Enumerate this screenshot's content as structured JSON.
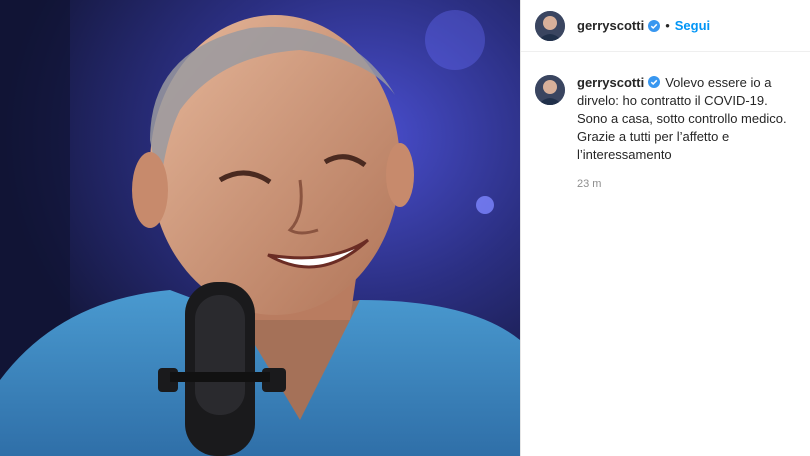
{
  "post": {
    "photo_alt": "Man smiling in front of a microphone"
  },
  "header": {
    "username": "gerryscotti",
    "separator": "•",
    "follow_label": "Segui"
  },
  "caption": {
    "username": "gerryscotti",
    "text": "Volevo essere io a dirvelo: ho contratto il COVID-19. Sono a casa, sotto controllo medico. Grazie a tutti per l’affetto e l’interessamento",
    "time": "23 m"
  },
  "colors": {
    "accent": "#0095f6",
    "text": "#262626",
    "muted": "#8e8e8e"
  },
  "icons": {
    "verified": "verified-badge-icon"
  }
}
